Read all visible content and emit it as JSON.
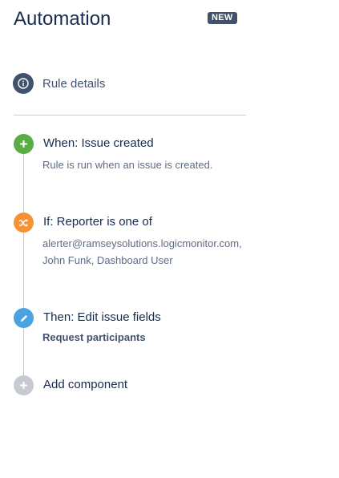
{
  "header": {
    "title": "Automation",
    "badge": "NEW"
  },
  "rule_details": {
    "label": "Rule details",
    "icon": "info-icon"
  },
  "steps": [
    {
      "title": "When: Issue created",
      "description": "Rule is run when an issue is created.",
      "icon": "plus-icon",
      "color": "#5aac44"
    },
    {
      "title": "If: Reporter is one of",
      "description": "alerter@ramseysolutions.logicmonitor.com, John Funk, Dashboard User",
      "icon": "shuffle-icon",
      "color": "#f79232"
    },
    {
      "title": "Then: Edit issue fields",
      "description": "Request participants",
      "icon": "pencil-icon",
      "color": "#4aa3df"
    },
    {
      "title": "Add component",
      "icon": "plus-icon",
      "color": "#c7cbd1"
    }
  ],
  "colors": {
    "title_text": "#172b4d",
    "badge_bg": "#42526e",
    "divider": "#c9cdd4"
  }
}
